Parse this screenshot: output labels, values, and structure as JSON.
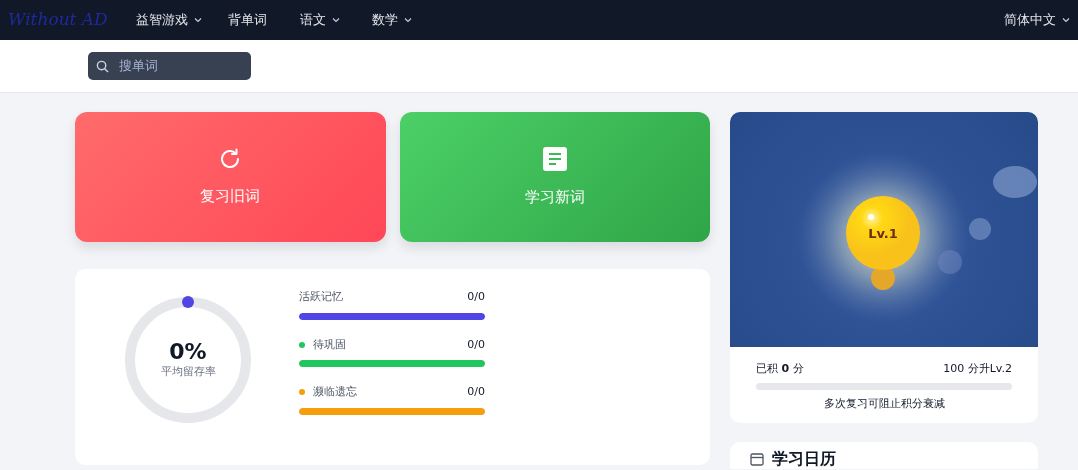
{
  "navbar": {
    "logo": "Without AD",
    "items": [
      {
        "label": "益智游戏",
        "dropdown": true
      },
      {
        "label": "背单词",
        "dropdown": false
      },
      {
        "label": "语文",
        "dropdown": true
      },
      {
        "label": "数学",
        "dropdown": true
      }
    ],
    "language": {
      "label": "简体中文",
      "dropdown": true
    }
  },
  "search": {
    "placeholder": "搜单词"
  },
  "actions": [
    {
      "kind": "review",
      "label": "复习旧词"
    },
    {
      "kind": "learn",
      "label": "学习新词"
    }
  ],
  "retention": {
    "value": "0%",
    "label": "平均留存率"
  },
  "memory_bars": [
    {
      "label": "活跃记忆",
      "count": "0/0",
      "color": "#4f46e5",
      "dot": false,
      "level": 1
    },
    {
      "label": "待巩固",
      "count": "0/0",
      "color": "#22c55e",
      "dot": true,
      "level": 1
    },
    {
      "label": "濒临遗忘",
      "count": "0/0",
      "color": "#f59e0b",
      "dot": true,
      "level": 1
    }
  ],
  "level_card": {
    "badge": "Lv.1",
    "points_label": "已积 **0** 分",
    "next_label": "100 分升Lv.2",
    "level": 0,
    "hint": "多次复习可阻止积分衰减"
  },
  "calendar": {
    "title": "学习日历"
  }
}
